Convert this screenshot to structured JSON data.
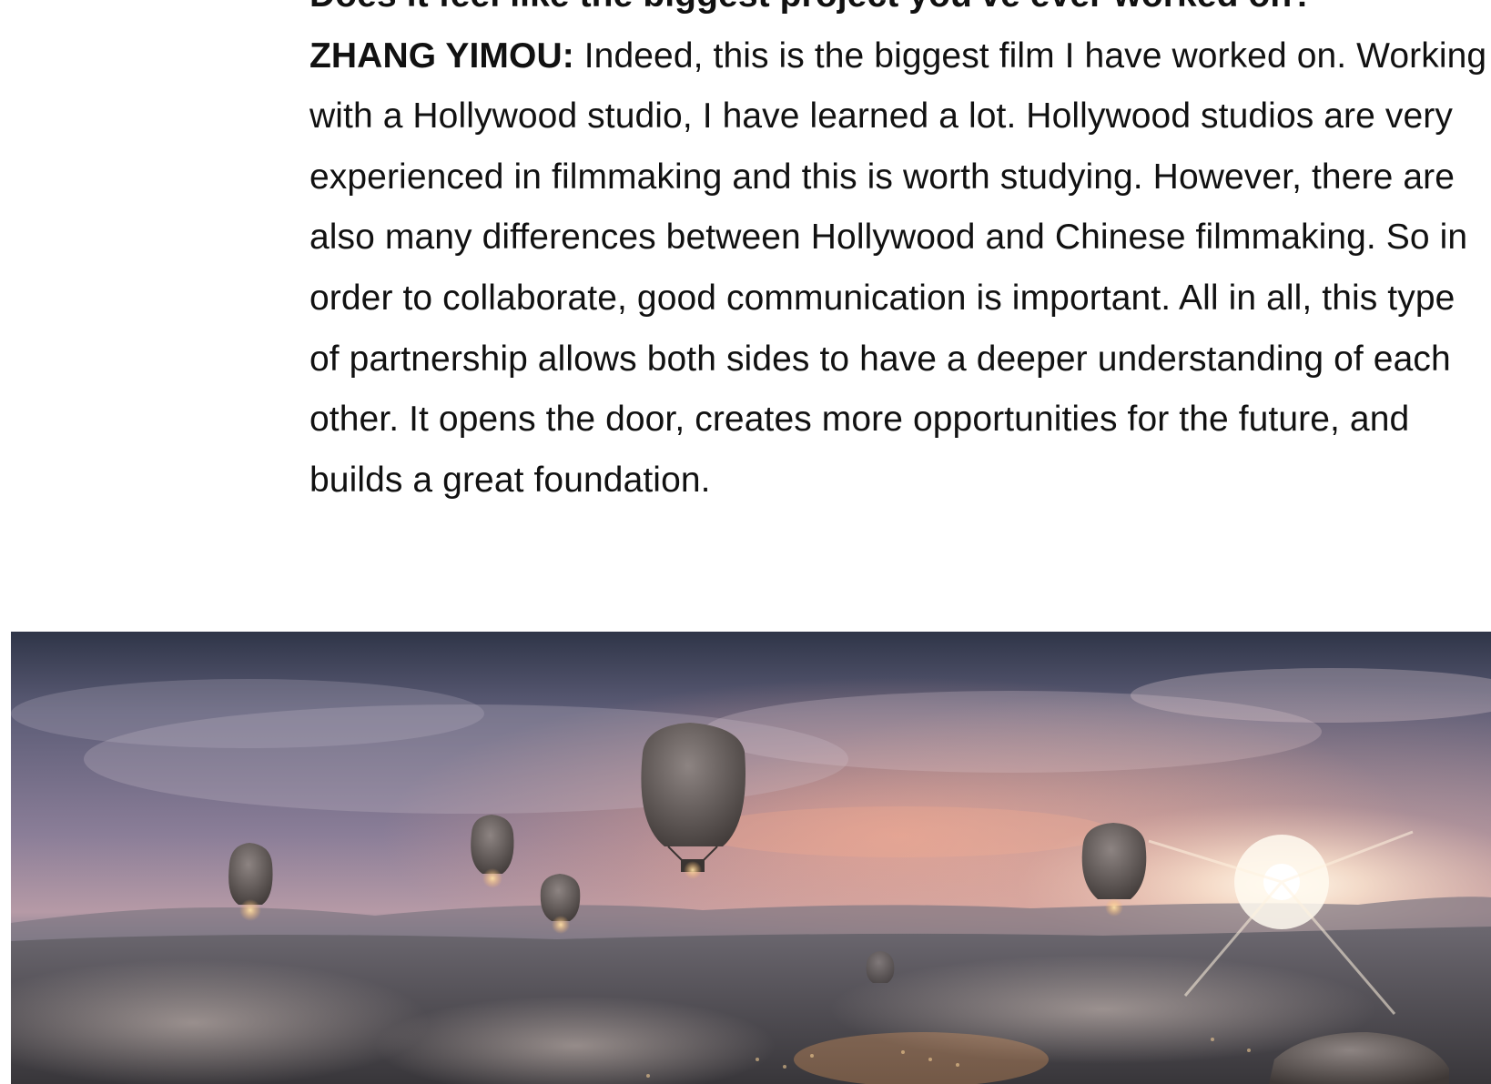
{
  "article": {
    "question": "Does it feel like the biggest project you've ever worked on?",
    "speaker": "ZHANG YIMOU:",
    "answer": " Indeed, this is the biggest film I have worked on. Working with a Hollywood studio, I have learned a lot. Hollywood studios are very experienced in filmmaking and this is worth studying. However, there are also many differences between Hollywood and Chinese filmmaking. So in order to collaborate, good communication is important. All in all, this type of partnership allows both sides to have a deeper understanding of each other. It opens the door, creates more opportunities for the future, and builds a great foundation."
  },
  "hero_image": {
    "palette": {
      "sky_top": "#2f3a4e",
      "sky_mid": "#7a6f88",
      "sunset": "#f0a98f",
      "sun": "#fff7e6",
      "ground": "#4d4a4e"
    }
  }
}
